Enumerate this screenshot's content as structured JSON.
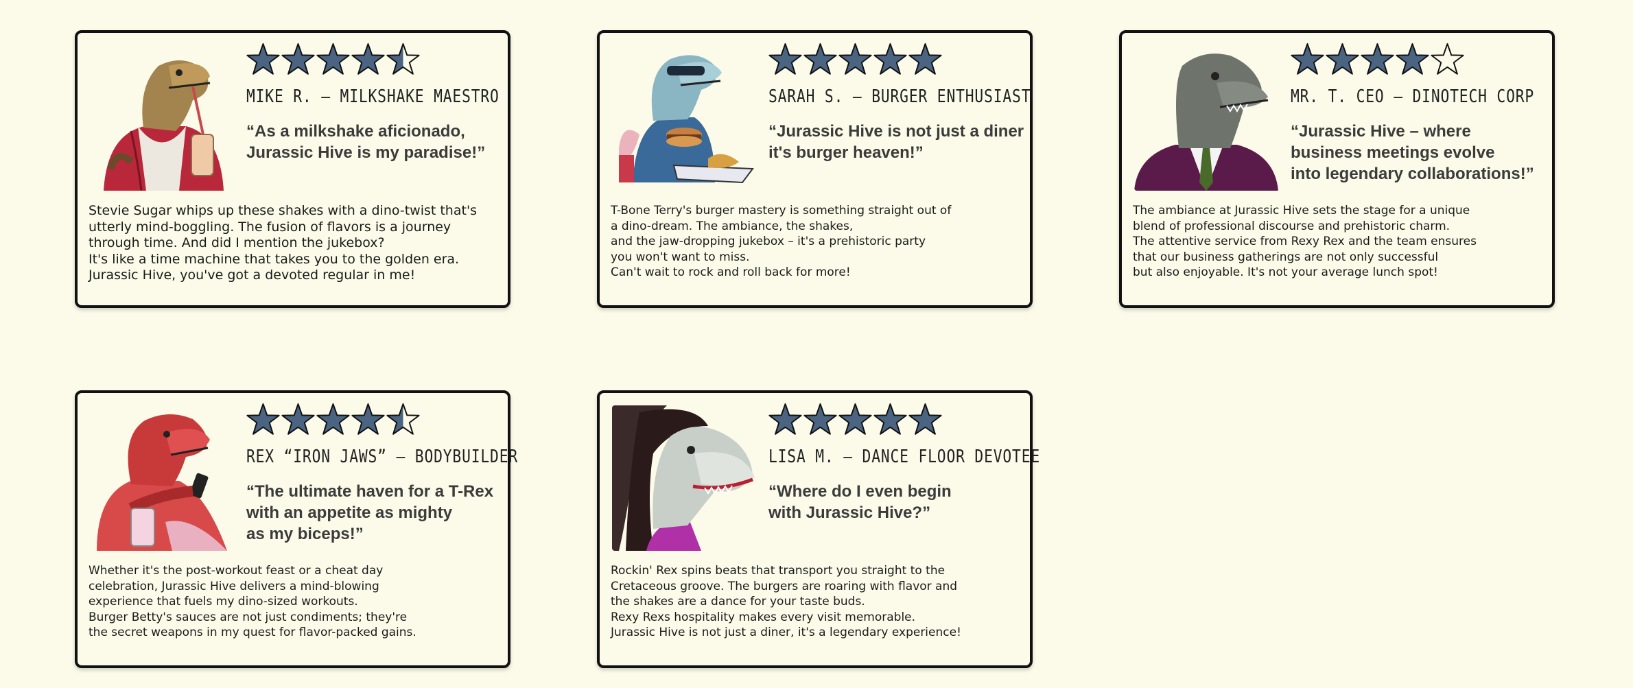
{
  "colors": {
    "page_bg": "#fcfbe9",
    "star_fill": "#4a6482",
    "border": "#111111"
  },
  "reviews": [
    {
      "avatar_icon": "trex-milkshake-hoodie-avatar",
      "rating": 4.5,
      "name": "Mike R. – Milkshake Maestro",
      "quote_lines": [
        "“As a milkshake aficionado,",
        " Jurassic Hive is my paradise!”"
      ],
      "body_lines": [
        "Stevie Sugar whips up these shakes with a dino-twist that's",
        "utterly mind-boggling. The fusion of flavors is a journey",
        "through time. And did I mention the jukebox?",
        "It's like a time machine that takes you to the golden era.",
        "Jurassic Hive, you've got a devoted regular in me!"
      ]
    },
    {
      "avatar_icon": "trex-burger-sunglasses-avatar",
      "rating": 5,
      "name": "Sarah S. – Burger Enthusiast",
      "quote_lines": [
        "“Jurassic Hive is not just a diner",
        "  it's burger heaven!”"
      ],
      "body_lines": [
        "T-Bone Terry's burger mastery is something straight out of",
        "a dino-dream. The ambiance, the shakes,",
        "and the jaw-dropping jukebox – it's a prehistoric party",
        "you won't want to miss.",
        "Can't wait to rock and roll back for more!"
      ]
    },
    {
      "avatar_icon": "trex-business-suit-avatar",
      "rating": 4,
      "name": "Mr. T. CEO – DinoTech Corp",
      "quote_lines": [
        "“Jurassic Hive – where",
        "  business meetings evolve",
        "  into legendary collaborations!”"
      ],
      "body_lines": [
        "The ambiance at Jurassic Hive sets the stage for a unique",
        "blend of professional discourse and prehistoric charm.",
        "The attentive service from Rexy Rex and the team ensures",
        "that our business gatherings are not only successful",
        "but also enjoyable. It's not your average lunch spot!"
      ]
    },
    {
      "avatar_icon": "trex-red-bodybuilder-avatar",
      "rating": 4.5,
      "name": "Rex “Iron Jaws” – Bodybuilder",
      "quote_lines": [
        "“The ultimate haven for a T-Rex",
        "  with an appetite as mighty",
        "  as my biceps!”"
      ],
      "body_lines": [
        "Whether it's the post-workout feast or a cheat day",
        "celebration, Jurassic Hive delivers a mind-blowing",
        "experience that fuels my dino-sized workouts.",
        "Burger Betty's sauces are not just condiments; they're",
        "the secret weapons in my quest for flavor-packed gains."
      ]
    },
    {
      "avatar_icon": "trex-dancer-long-hair-avatar",
      "rating": 5,
      "name": "Lisa M. – Dance Floor Devotee",
      "quote_lines": [
        "“Where do I even begin",
        "  with Jurassic Hive?”"
      ],
      "body_lines": [
        "Rockin' Rex spins beats that transport you straight to the",
        "Cretaceous groove. The burgers are roaring with flavor and",
        "the shakes are a dance for your taste buds.",
        "Rexy Rexs hospitality makes every visit memorable.",
        "Jurassic Hive is not just a diner, it's a legendary experience!"
      ]
    }
  ]
}
